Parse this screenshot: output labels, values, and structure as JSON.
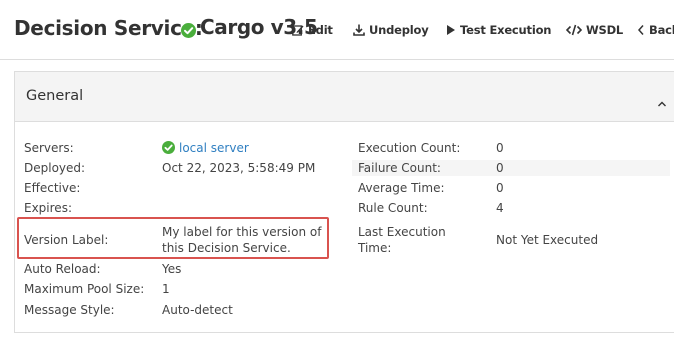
{
  "header": {
    "title": "Decision Service:",
    "service_name": "Cargo v3.5",
    "toolbar": {
      "edit_label": "Edit",
      "undeploy_label": "Undeploy",
      "test_execution_label": "Test Execution",
      "wsdl_label": "WSDL",
      "back_label": "Back"
    }
  },
  "panel": {
    "title": "General",
    "left": [
      {
        "label": "Servers:",
        "value": "local server"
      },
      {
        "label": "Deployed:",
        "value": "Oct 22, 2023, 5:58:49 PM"
      },
      {
        "label": "Effective:",
        "value": ""
      },
      {
        "label": "Expires:",
        "value": ""
      },
      {
        "label": "Version Label:",
        "value_line1": "My label for this version of",
        "value_line2": "this Decision Service."
      },
      {
        "label": "Auto Reload:",
        "value": "Yes"
      },
      {
        "label": "Maximum Pool Size:",
        "value": "1"
      },
      {
        "label": "Message Style:",
        "value": "Auto-detect"
      }
    ],
    "right": [
      {
        "label": "Execution Count:",
        "value": "0"
      },
      {
        "label": "Failure Count:",
        "value": "0"
      },
      {
        "label": "Average Time:",
        "value": "0"
      },
      {
        "label": "Rule Count:",
        "value": "4"
      },
      {
        "label_line1": "Last Execution",
        "label_line2": "Time:",
        "value": "Not Yet Executed"
      }
    ]
  },
  "colors": {
    "success": "#4aae3c",
    "link": "#2f7fc1",
    "highlight": "#d9534f"
  },
  "icons": {
    "status": "check-circle-icon",
    "edit": "edit-icon",
    "undeploy": "download-icon",
    "test": "play-icon",
    "wsdl": "code-icon",
    "back": "chevron-left-icon",
    "collapse": "chevron-up-icon"
  }
}
